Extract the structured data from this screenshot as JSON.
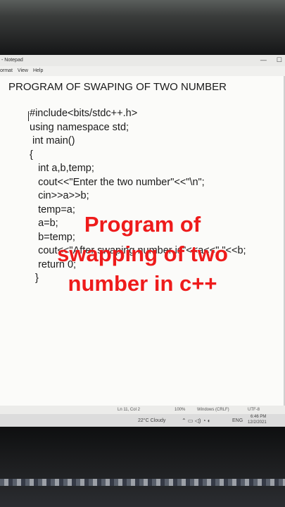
{
  "window": {
    "title": "- Notepad",
    "controls": [
      "—",
      "☐"
    ]
  },
  "menu": [
    "ormat",
    "View",
    "Help"
  ],
  "document": {
    "heading": "PROGRAM OF SWAPING OF TWO NUMBER",
    "code_lines": [
      "#include<bits/stdc++.h>",
      "using namespace std;",
      " int main()",
      "{",
      "   int a,b,temp;",
      "   cout<<\"Enter the two number\"<<\"\\n\";",
      "   cin>>a>>b;",
      "   temp=a;",
      "   a=b;",
      "   b=temp;",
      "   cout<<\"After swaping number is\"<<a<<\" \"<<b;",
      "   return 0;",
      "  }"
    ]
  },
  "status": {
    "position": "Ln 11, Col 2",
    "zoom": "100%",
    "line_ending": "Windows (CRLF)",
    "encoding": "UTF-8"
  },
  "taskbar": {
    "weather": "22°C  Cloudy",
    "language": "ENG",
    "time": "6:46 PM",
    "date": "12/2/2021"
  },
  "overlay": {
    "lines": [
      "Program of",
      "swapping of two",
      "number in c++"
    ]
  },
  "colors": {
    "overlay_text": "#ee1b1b"
  }
}
